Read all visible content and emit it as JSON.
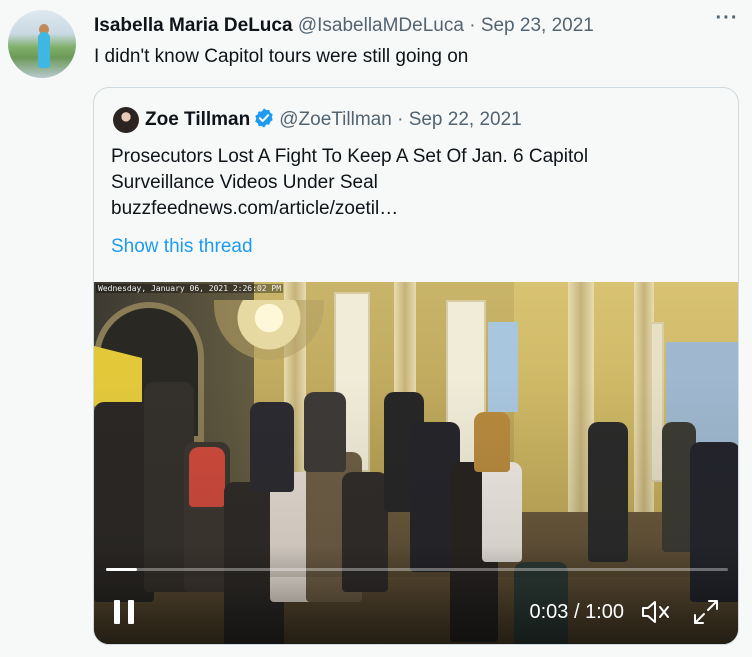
{
  "tweet": {
    "author_name": "Isabella Maria DeLuca",
    "author_handle": "@IsabellaMDeLuca",
    "separator": " · ",
    "date": "Sep 23, 2021",
    "more_icon": "···",
    "text": "I didn't know Capitol tours were still going on"
  },
  "quote": {
    "author_name": "Zoe Tillman",
    "verified_icon": "verified-badge-icon",
    "author_handle": "@ZoeTillman",
    "separator": " · ",
    "date": "Sep 22, 2021",
    "text_line1": "Prosecutors Lost A Fight To Keep A Set Of Jan. 6 Capitol",
    "text_line2": "Surveillance Videos Under Seal",
    "text_line3": "buzzfeednews.com/article/zoetil…",
    "show_thread": "Show this thread"
  },
  "video": {
    "overlay_timestamp": "Wednesday, January 06, 2021 2:26:02 PM",
    "current_time": "0:03",
    "time_separator": " / ",
    "duration": "1:00",
    "progress_percent": 5,
    "controls": {
      "pause_icon": "pause-icon",
      "mute_icon": "muted-speaker-icon",
      "fullscreen_icon": "fullscreen-icon"
    },
    "colors": {
      "progress_fill": "#ffffff",
      "progress_track": "rgba(255,255,255,0.35)"
    }
  },
  "colors": {
    "link": "#1d9bf0",
    "secondary_text": "#536471",
    "verified": "#1d9bf0",
    "background": "#f7f9f9"
  }
}
